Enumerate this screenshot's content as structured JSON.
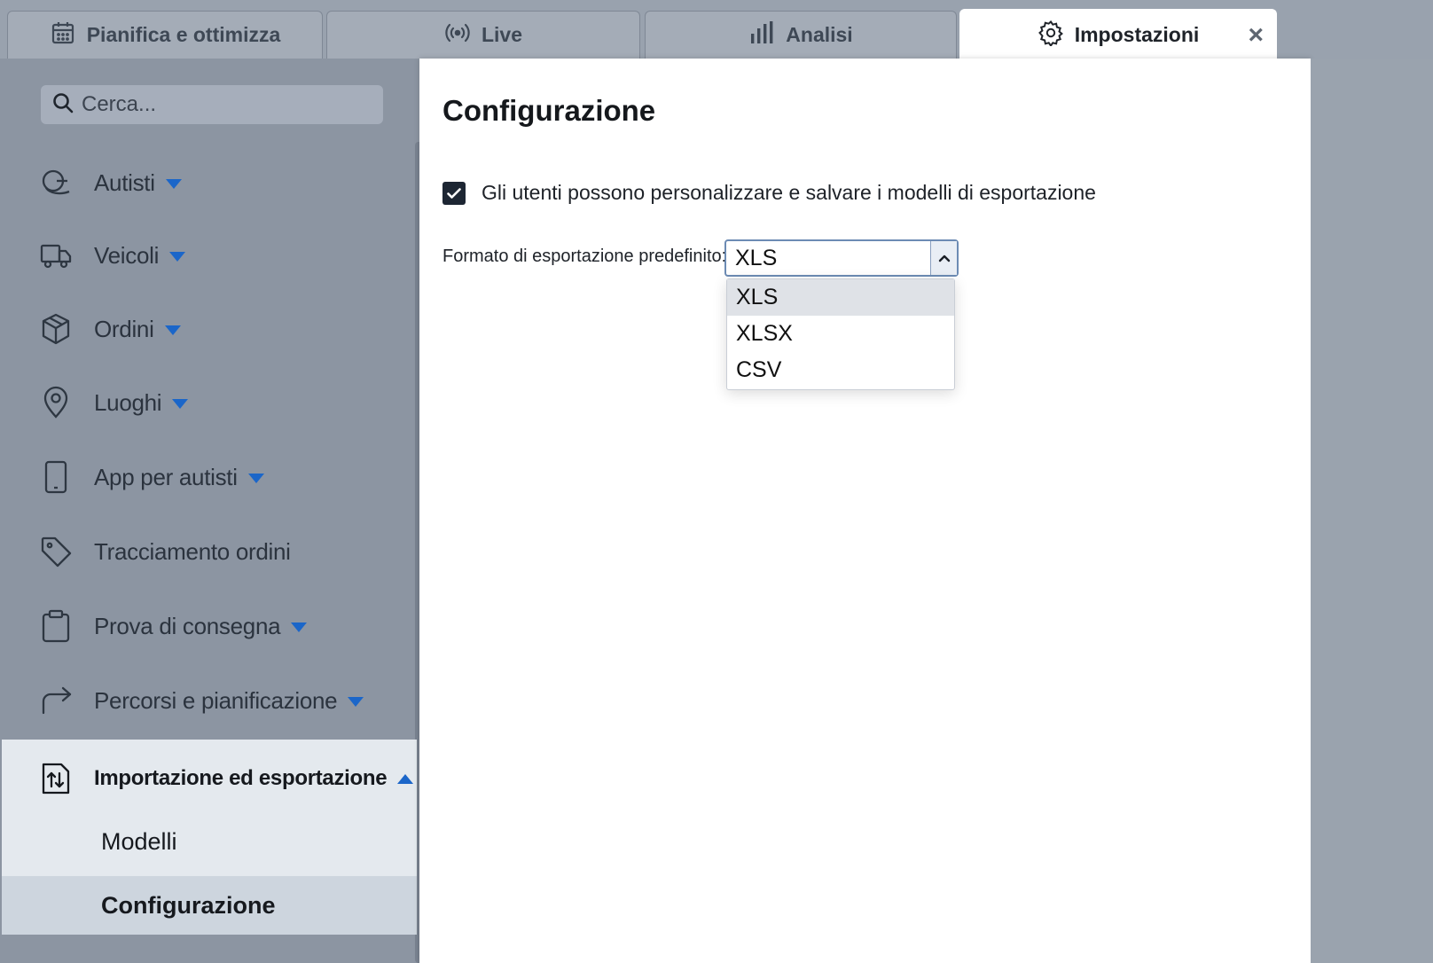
{
  "tabs": [
    {
      "label": "Pianifica e ottimizza",
      "icon": "calendar-icon"
    },
    {
      "label": "Live",
      "icon": "broadcast-icon"
    },
    {
      "label": "Analisi",
      "icon": "bar-chart-icon"
    },
    {
      "label": "Impostazioni",
      "icon": "gear-icon",
      "active": true,
      "close": "×"
    }
  ],
  "sidebar": {
    "search_placeholder": "Cerca...",
    "items": [
      {
        "label": "Autisti",
        "icon": "driver-icon"
      },
      {
        "label": "Veicoli",
        "icon": "truck-icon"
      },
      {
        "label": "Ordini",
        "icon": "package-icon"
      },
      {
        "label": "Luoghi",
        "icon": "location-pin-icon"
      },
      {
        "label": "App per autisti",
        "icon": "mobile-icon"
      },
      {
        "label": "Tracciamento ordini",
        "icon": "tag-icon"
      },
      {
        "label": "Prova di consegna",
        "icon": "clipboard-icon"
      },
      {
        "label": "Percorsi e pianificazione",
        "icon": "route-arrow-icon"
      },
      {
        "label": "Importazione ed esportazione",
        "icon": "import-export-icon",
        "expanded": true
      }
    ],
    "subitems": [
      {
        "label": "Modelli"
      },
      {
        "label": "Configurazione",
        "selected": true
      }
    ]
  },
  "main": {
    "title": "Configurazione",
    "checkbox_label": "Gli utenti possono personalizzare e salvare i modelli di esportazione",
    "checkbox_checked": true,
    "format_label": "Formato di esportazione predefinito:",
    "format_value": "XLS",
    "format_options": [
      "XLS",
      "XLSX",
      "CSV"
    ]
  },
  "colors": {
    "accent": "#1b66c9",
    "sidebar_bg": "#8c95a2",
    "checkbox": "#1d2633"
  }
}
